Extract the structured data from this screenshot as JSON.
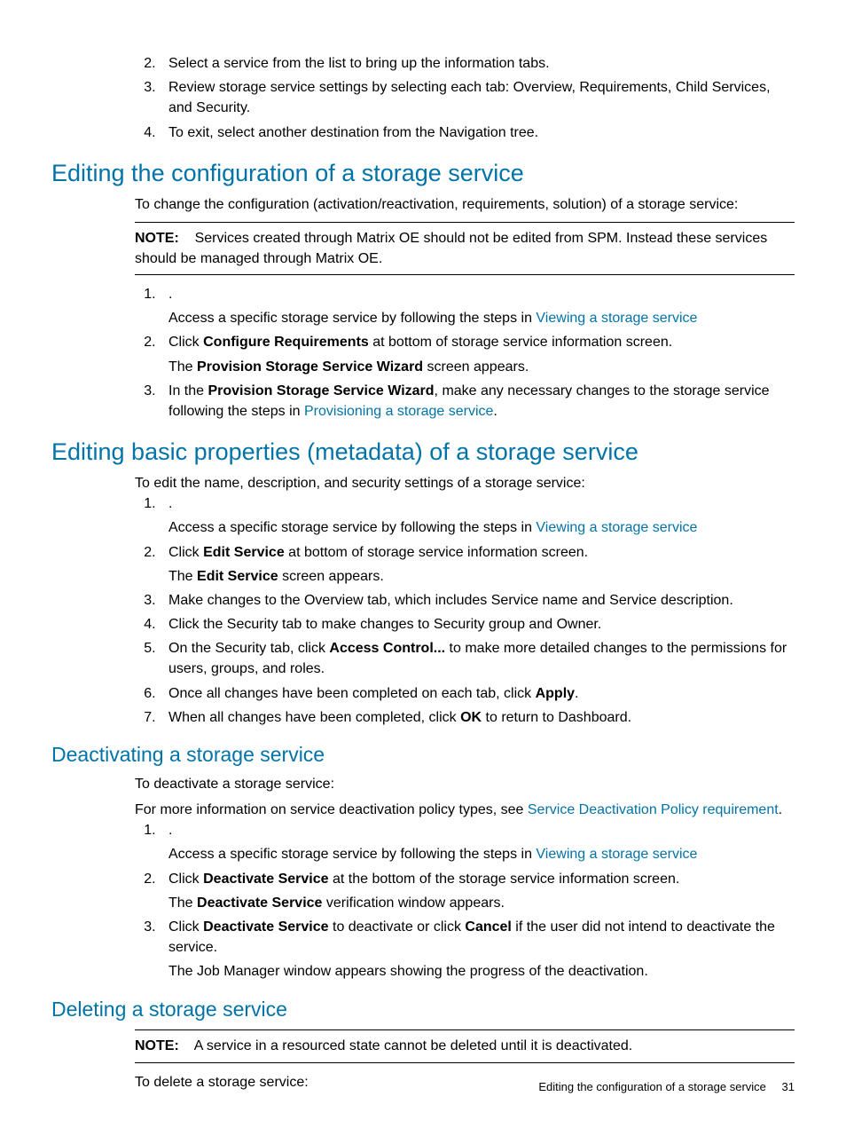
{
  "intro_steps_start": 2,
  "intro_steps": [
    "Select a service from the list to bring up the information tabs.",
    "Review storage service settings by selecting each tab: Overview, Requirements, Child Services, and Security.",
    "To exit, select another destination from the Navigation tree."
  ],
  "s1": {
    "heading": "Editing the configuration of a storage service",
    "intro": "To change the configuration (activation/reactivation, requirements, solution) of a storage service:",
    "note_label": "NOTE:",
    "note": "Services created through Matrix OE should not be edited from SPM. Instead these services should be managed through Matrix OE.",
    "step1_prefix": ".",
    "step1_text": "Access a specific storage service by following the steps in ",
    "step1_link": "Viewing a storage service",
    "step2_a": "Click ",
    "step2_b": "Configure Requirements",
    "step2_c": " at bottom of storage service information screen.",
    "step2p_a": "The ",
    "step2p_b": "Provision Storage Service Wizard",
    "step2p_c": " screen appears.",
    "step3_a": "In the ",
    "step3_b": "Provision Storage Service Wizard",
    "step3_c": ", make any necessary changes to the storage service following the steps in ",
    "step3_link": "Provisioning a storage service",
    "step3_d": "."
  },
  "s2": {
    "heading": "Editing basic properties (metadata) of a storage service",
    "intro": "To edit the name, description, and security settings of a storage service:",
    "step1_prefix": ".",
    "step1_text": "Access a specific storage service by following the steps in ",
    "step1_link": "Viewing a storage service",
    "step2_a": "Click ",
    "step2_b": "Edit Service",
    "step2_c": " at bottom of storage service information screen.",
    "step2p_a": "The ",
    "step2p_b": "Edit Service",
    "step2p_c": " screen appears.",
    "step3": "Make changes to the Overview tab, which includes Service name and Service description.",
    "step4": "Click the Security tab to make changes to Security group and Owner.",
    "step5_a": "On the Security tab, click ",
    "step5_b": "Access Control...",
    "step5_c": " to make more detailed changes to the permissions for users, groups, and roles.",
    "step6_a": "Once all changes have been completed on each tab, click ",
    "step6_b": "Apply",
    "step6_c": ".",
    "step7_a": "When all changes have been completed, click ",
    "step7_b": "OK",
    "step7_c": " to return to Dashboard."
  },
  "s3": {
    "heading": "Deactivating a storage service",
    "intro": "To deactivate a storage service:",
    "more_a": "For more information on service deactivation policy types, see ",
    "more_link": "Service Deactivation Policy requirement",
    "more_b": ".",
    "step1_prefix": ".",
    "step1_text": "Access a specific storage service by following the steps in ",
    "step1_link": "Viewing a storage service",
    "step2_a": "Click ",
    "step2_b": "Deactivate Service",
    "step2_c": " at the bottom of the storage service information screen.",
    "step2p_a": "The ",
    "step2p_b": "Deactivate Service",
    "step2p_c": " verification window appears.",
    "step3_a": "Click ",
    "step3_b": "Deactivate Service",
    "step3_c": " to deactivate or click ",
    "step3_d": "Cancel",
    "step3_e": " if the user did not intend to deactivate the service.",
    "step3p": "The Job Manager window appears showing the progress of the deactivation."
  },
  "s4": {
    "heading": "Deleting a storage service",
    "note_label": "NOTE:",
    "note": "A service in a resourced state cannot be deleted until it is deactivated.",
    "intro": "To delete a storage service:"
  },
  "footer": {
    "text": "Editing the configuration of a storage service",
    "page": "31"
  }
}
